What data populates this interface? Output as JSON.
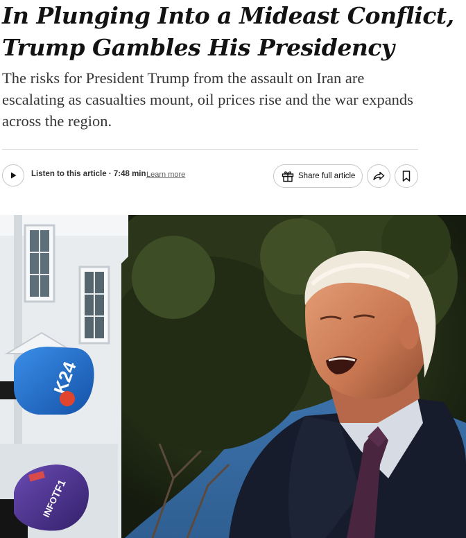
{
  "article": {
    "headline": "In Plunging Into a Mideast Conflict, Trump Gambles His Presidency",
    "summary": "The risks for President Trump from the assault on Iran are escalating as casualties mount, oil prices rise and the war expands across the region."
  },
  "audio": {
    "play_icon": "play-icon",
    "listen_label": "Listen to this article · 7:48 min",
    "learn_more": "Learn more"
  },
  "actions": {
    "share_label": "Share full article",
    "share_icon": "gift-icon",
    "forward_icon": "forward-share-icon",
    "bookmark_icon": "bookmark-icon"
  },
  "photo": {
    "mic_left_logo": "K24",
    "mic_lower_logo_top": "TF1",
    "mic_lower_logo_bottom": "INFO"
  },
  "colors": {
    "text": "#121212",
    "summary": "#363636",
    "border": "#c7c7c7",
    "mic_blue": "#1f6fd0",
    "mic_purple": "#4b2f8a"
  }
}
